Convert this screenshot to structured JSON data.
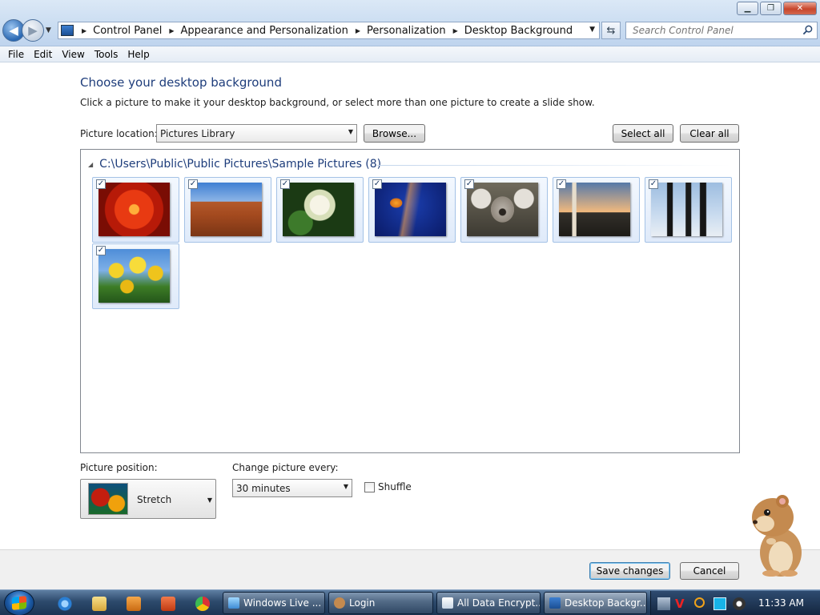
{
  "window": {
    "minimize_glyph": "▁",
    "maximize_glyph": "❐",
    "close_glyph": "✕"
  },
  "address": {
    "breadcrumbs": [
      "Control Panel",
      "Appearance and Personalization",
      "Personalization",
      "Desktop Background"
    ],
    "search_placeholder": "Search Control Panel"
  },
  "menu": [
    "File",
    "Edit",
    "View",
    "Tools",
    "Help"
  ],
  "main": {
    "title": "Choose your desktop background",
    "description": "Click a picture to make it your desktop background, or select more than one picture to create a slide show.",
    "location_label": "Picture location:",
    "location_value": "Pictures Library",
    "browse_label": "Browse...",
    "select_all_label": "Select all",
    "clear_all_label": "Clear all",
    "group_header": "C:\\Users\\Public\\Public Pictures\\Sample Pictures (8)",
    "pictures": [
      {
        "name": "chrysanthemum-thumbnail",
        "checked": true
      },
      {
        "name": "desert-thumbnail",
        "checked": true
      },
      {
        "name": "hydrangeas-thumbnail",
        "checked": true
      },
      {
        "name": "jellyfish-thumbnail",
        "checked": true
      },
      {
        "name": "koala-thumbnail",
        "checked": true
      },
      {
        "name": "lighthouse-thumbnail",
        "checked": true
      },
      {
        "name": "penguins-thumbnail",
        "checked": true
      },
      {
        "name": "tulips-thumbnail",
        "checked": true
      }
    ],
    "position_label": "Picture position:",
    "position_value": "Stretch",
    "change_label": "Change picture every:",
    "change_value": "30 minutes",
    "shuffle_label": "Shuffle",
    "shuffle_checked": false,
    "save_label": "Save changes",
    "cancel_label": "Cancel"
  },
  "taskbar": {
    "tasks": [
      "Windows Live ...",
      "Login",
      "All Data Encrypt...",
      "Desktop Backgr..."
    ],
    "active_task": "Desktop Backgr...",
    "clock": "11:33 AM"
  },
  "colors": {
    "title_blue": "#1e3d7b",
    "selection_border": "#a4c2e6",
    "taskbar": "#1c3554"
  }
}
